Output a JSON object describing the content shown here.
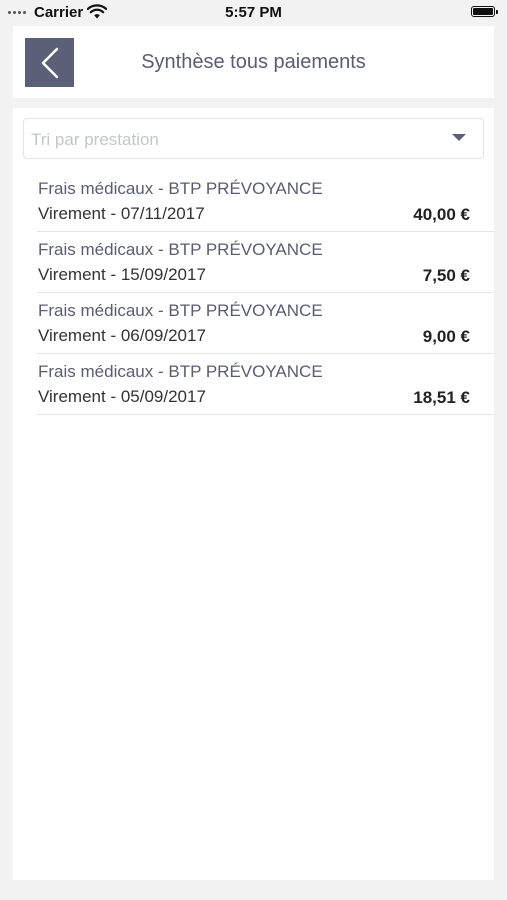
{
  "status_bar": {
    "carrier": "Carrier",
    "time": "5:57 PM",
    "icons": [
      "signal-dots-icon",
      "wifi-icon",
      "battery-icon"
    ]
  },
  "header": {
    "title": "Synthèse tous paiements",
    "back_icon": "chevron-left-icon",
    "accent_color": "#5b5f77"
  },
  "filter": {
    "placeholder": "Tri par prestation",
    "icon": "dropdown-arrow-icon"
  },
  "payments": [
    {
      "label": "Frais médicaux - BTP PRÉVOYANCE",
      "detail": "Virement - 07/11/2017",
      "amount": "40,00 €"
    },
    {
      "label": "Frais médicaux - BTP PRÉVOYANCE",
      "detail": "Virement - 15/09/2017",
      "amount": "7,50 €"
    },
    {
      "label": "Frais médicaux - BTP PRÉVOYANCE",
      "detail": "Virement - 06/09/2017",
      "amount": "9,00 €"
    },
    {
      "label": "Frais médicaux - BTP PRÉVOYANCE",
      "detail": "Virement - 05/09/2017",
      "amount": "18,51 €"
    }
  ]
}
